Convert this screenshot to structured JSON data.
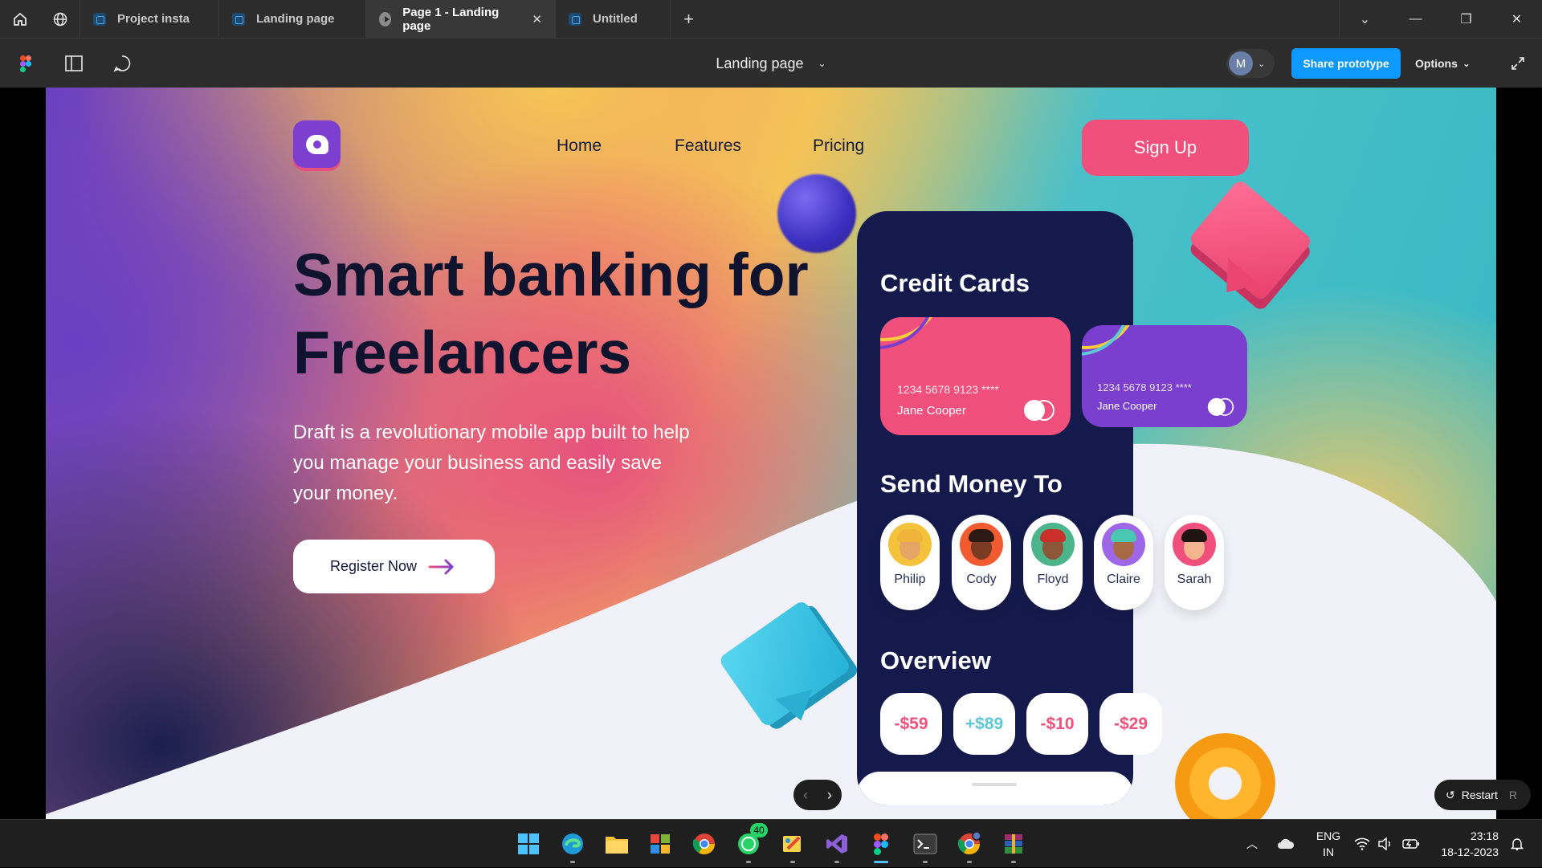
{
  "titlebar": {
    "tabs": [
      {
        "label": "Project insta",
        "icon": "figma-file-icon"
      },
      {
        "label": "Landing page",
        "icon": "figma-file-icon"
      },
      {
        "label": "Page 1 - Landing page",
        "icon": "play-icon",
        "active": true
      },
      {
        "label": "Untitled",
        "icon": "figma-file-icon"
      }
    ],
    "add_tab": "+"
  },
  "toolbar": {
    "title": "Landing page",
    "avatar_initial": "M",
    "share_label": "Share prototype",
    "options_label": "Options"
  },
  "landing": {
    "nav": [
      "Home",
      "Features",
      "Pricing"
    ],
    "signup_label": "Sign Up",
    "hero_title": "Smart banking for Freelancers",
    "hero_desc": "Draft is a revolutionary mobile app built to help you manage your business and easily save your money.",
    "register_label": "Register Now"
  },
  "phone": {
    "credit_title": "Credit Cards",
    "cards": [
      {
        "number": "1234 5678 9123 ****",
        "holder": "Jane Cooper",
        "color": "#f0507b"
      },
      {
        "number": "1234 5678 9123 ****",
        "holder": "Jane Cooper",
        "color": "#7b3fcf"
      }
    ],
    "send_title": "Send Money To",
    "contacts": [
      {
        "name": "Philip",
        "bg": "#f5c33b",
        "skin": "#e7a565",
        "hair": "#f0b43a"
      },
      {
        "name": "Cody",
        "bg": "#f25a2f",
        "skin": "#7a3a24",
        "hair": "#2b1a12"
      },
      {
        "name": "Floyd",
        "bg": "#4bb48b",
        "skin": "#8c5638",
        "hair": "#c9302a"
      },
      {
        "name": "Claire",
        "bg": "#9d67e8",
        "skin": "#a76a45",
        "hair": "#4ac7b0"
      },
      {
        "name": "Sarah",
        "bg": "#f0507b",
        "skin": "#f3b48f",
        "hair": "#1f1410"
      }
    ],
    "overview_title": "Overview",
    "amounts": [
      {
        "value": "-$59",
        "color": "#f0507b"
      },
      {
        "value": "+$89",
        "color": "#5fc8d8"
      },
      {
        "value": "-$10",
        "color": "#f0507b"
      },
      {
        "value": "-$29",
        "color": "#f0507b"
      }
    ]
  },
  "player": {
    "restart_label": "Restart",
    "restart_key": "R"
  },
  "taskbar": {
    "whatsapp_badge": "40",
    "lang_top": "ENG",
    "lang_bottom": "IN",
    "time": "23:18",
    "date": "18-12-2023"
  }
}
